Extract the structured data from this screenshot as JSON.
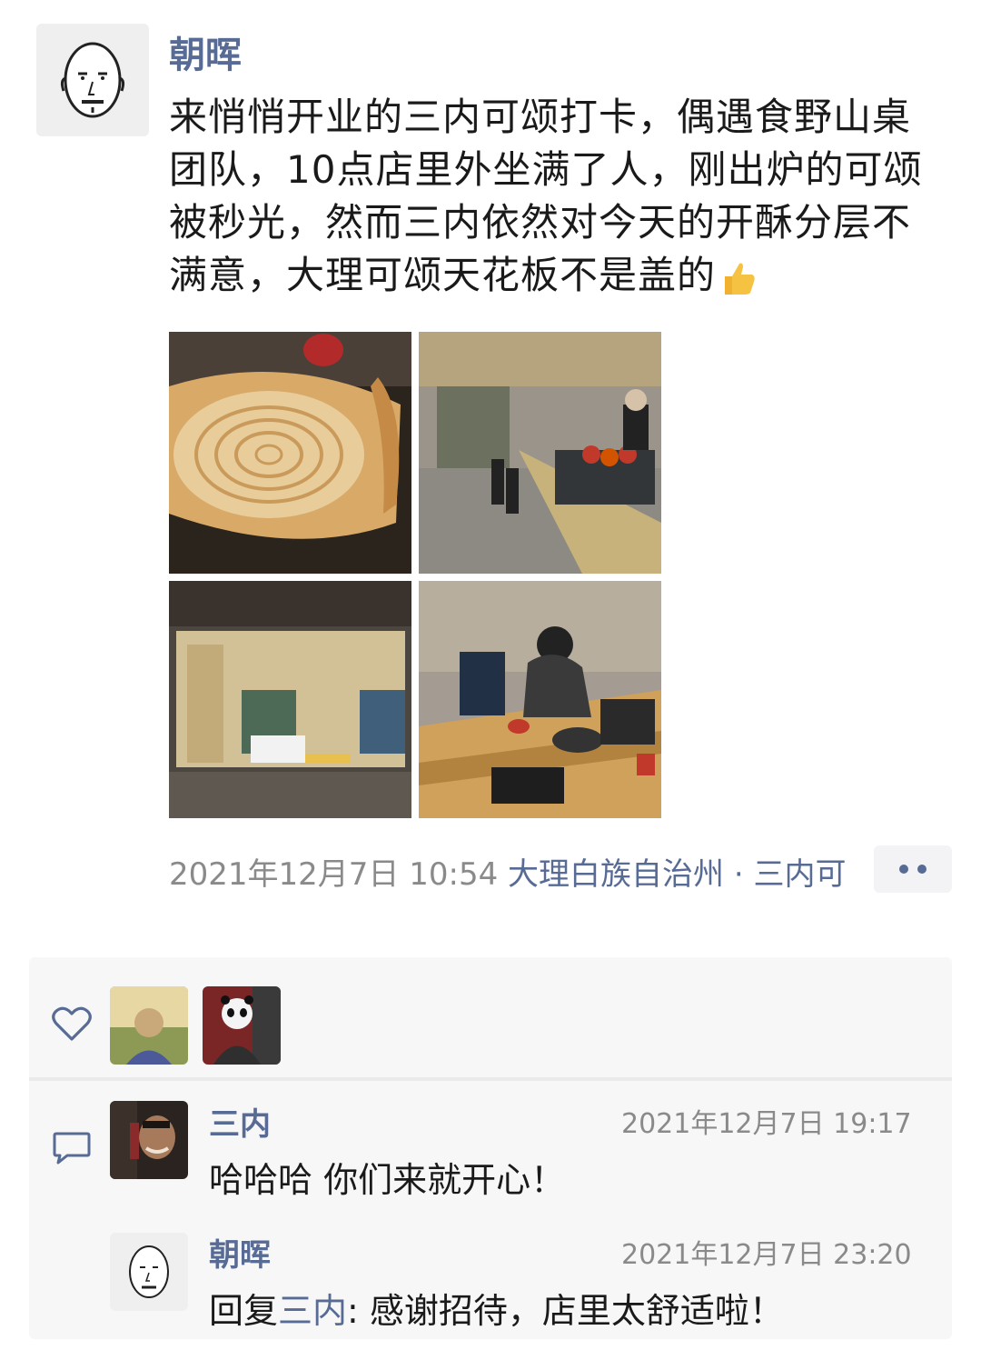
{
  "post": {
    "author": "朝晖",
    "text": "来悄悄开业的三内可颂打卡，偶遇食野山桌团队，10点店里外坐满了人，刚出炉的可颂被秒光，然而三内依然对今天的开酥分层不满意，大理可颂天花板不是盖的",
    "emoji": "thumbs-up-emoji",
    "timestamp": "2021年12月7日 10:54",
    "location": "大理白族自治州 · 三内可"
  },
  "photos": [
    {
      "name": "croissant-photo"
    },
    {
      "name": "cafe-counter-photo"
    },
    {
      "name": "kitchen-window-photo"
    },
    {
      "name": "laptop-table-photo"
    }
  ],
  "likes": {
    "icon": "heart-icon",
    "avatars": [
      "liker-avatar-1",
      "liker-avatar-2"
    ]
  },
  "comments": [
    {
      "author": "三内",
      "time": "2021年12月7日 19:17",
      "text": "哈哈哈 你们来就开心！"
    },
    {
      "author": "朝晖",
      "time": "2021年12月7日 23:20",
      "reply_prefix": "回复",
      "reply_to": "三内",
      "text": ": 感谢招待，店里太舒适啦！"
    }
  ],
  "colors": {
    "link": "#576b95",
    "meta": "#8a8a8a",
    "panel": "#f7f7f7"
  }
}
